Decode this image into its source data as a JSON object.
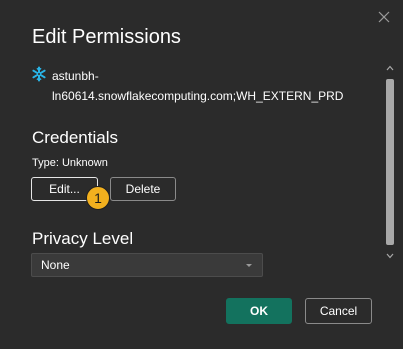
{
  "dialog": {
    "title": "Edit Permissions",
    "close_icon": "close-icon"
  },
  "source": {
    "icon": "snowflake-icon",
    "icon_color": "#29b5e8",
    "line1": "astunbh-",
    "line2": "ln60614.snowflakecomputing.com;WH_EXTERN_PRD"
  },
  "credentials": {
    "heading": "Credentials",
    "type_text": "Type: Unknown",
    "edit_label": "Edit...",
    "delete_label": "Delete",
    "badge_number": "1",
    "badge_color": "#f2b01e"
  },
  "privacy": {
    "heading": "Privacy Level",
    "selected": "None"
  },
  "footer": {
    "ok_label": "OK",
    "cancel_label": "Cancel",
    "ok_color": "#13725e"
  },
  "scrollbar": {
    "up_icon": "chevron-up-icon",
    "down_icon": "chevron-down-icon"
  }
}
